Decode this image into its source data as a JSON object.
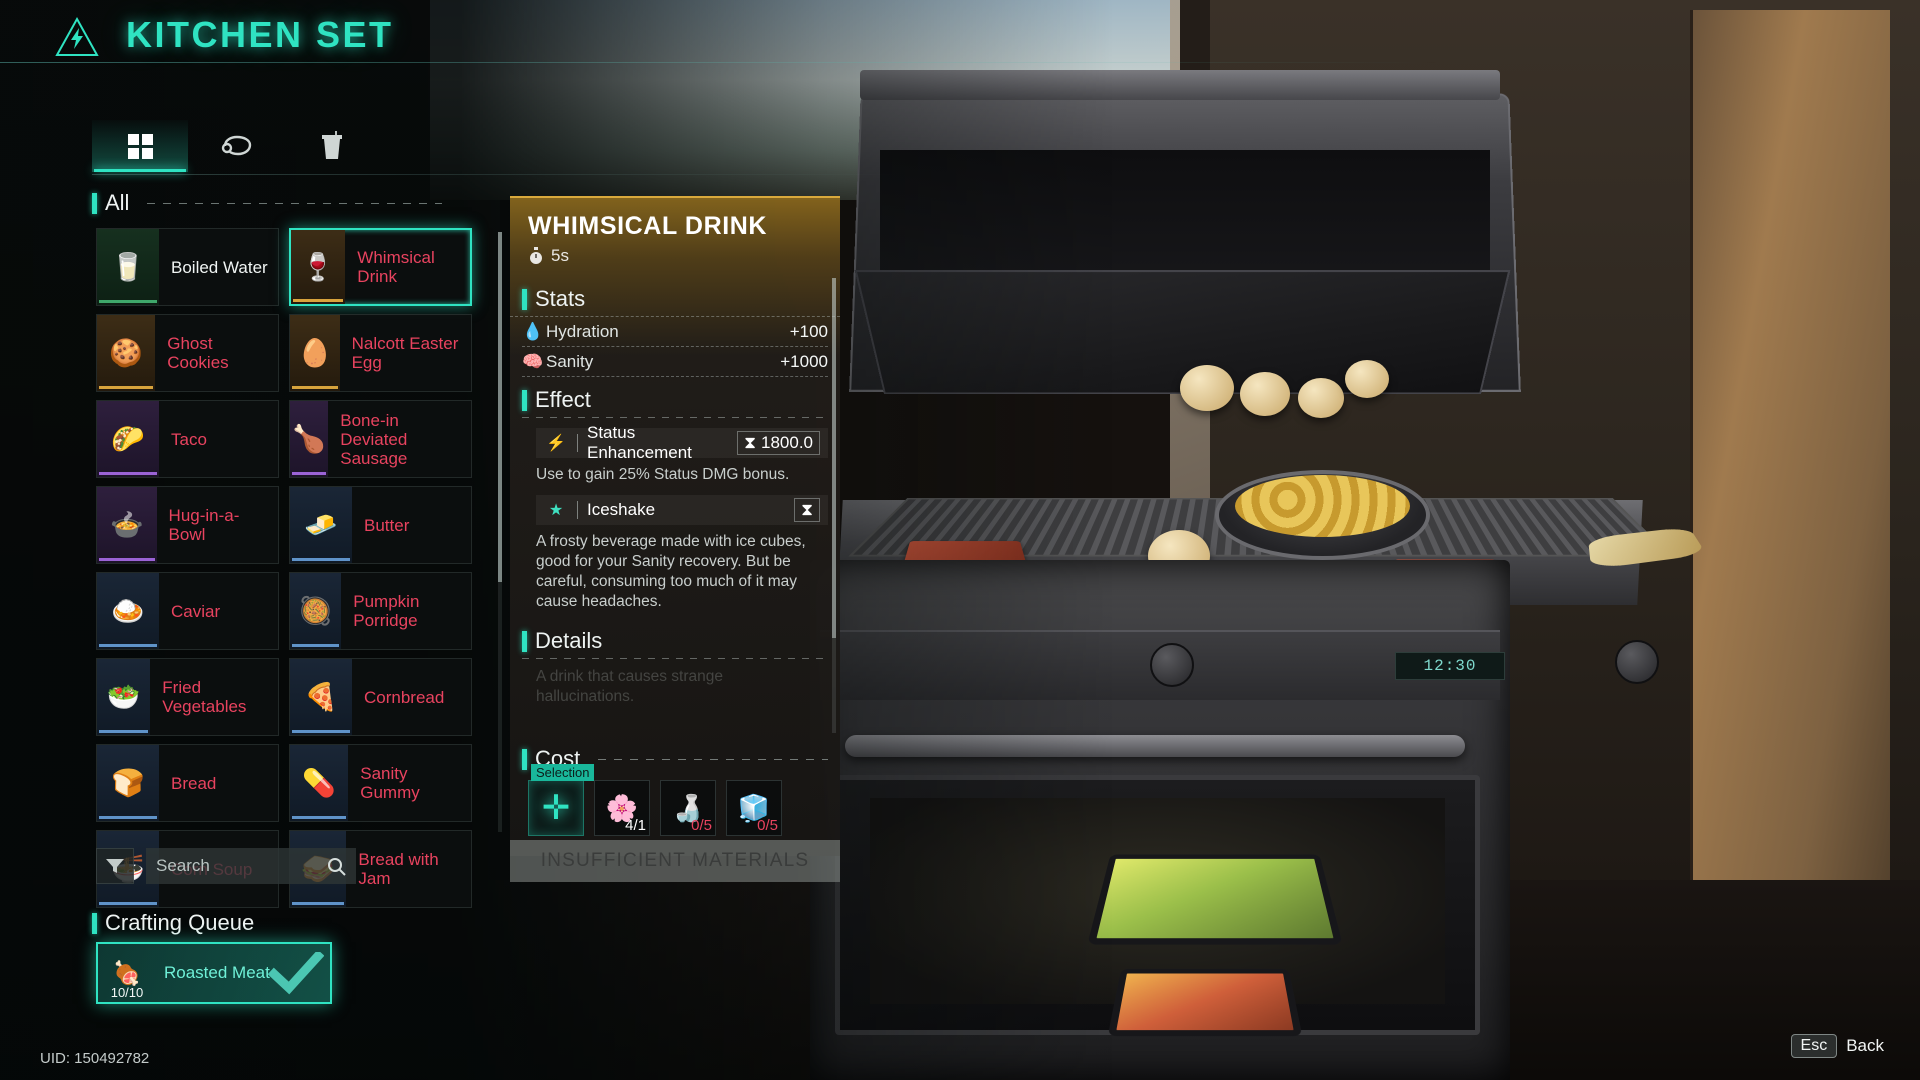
{
  "header": {
    "title": "KITCHEN SET",
    "warn_icon": "warning-lightning-icon"
  },
  "tabs": [
    {
      "id": "all",
      "icon": "grid-icon",
      "glyph": "▦",
      "active": true
    },
    {
      "id": "food",
      "icon": "meat-icon",
      "glyph": "🍖",
      "active": false
    },
    {
      "id": "drink",
      "icon": "drink-cup-icon",
      "glyph": "🥤",
      "active": false
    }
  ],
  "list": {
    "section_label": "All",
    "items": [
      {
        "name": "Boiled Water",
        "glyph": "🥛",
        "rarity": "green",
        "craftable": true
      },
      {
        "name": "Whimsical Drink",
        "glyph": "🍷",
        "rarity": "gold",
        "craftable": false,
        "selected": true
      },
      {
        "name": "Ghost Cookies",
        "glyph": "🍪",
        "rarity": "gold",
        "craftable": false
      },
      {
        "name": "Nalcott Easter Egg",
        "glyph": "🥚",
        "rarity": "gold",
        "craftable": false
      },
      {
        "name": "Taco",
        "glyph": "🌮",
        "rarity": "purple",
        "craftable": false
      },
      {
        "name": "Bone-in Deviated Sausage",
        "glyph": "🍗",
        "rarity": "purple",
        "craftable": false
      },
      {
        "name": "Hug-in-a-Bowl",
        "glyph": "🍲",
        "rarity": "purple",
        "craftable": false
      },
      {
        "name": "Butter",
        "glyph": "🧈",
        "rarity": "blue",
        "craftable": false
      },
      {
        "name": "Caviar",
        "glyph": "🍛",
        "rarity": "blue",
        "craftable": false
      },
      {
        "name": "Pumpkin Porridge",
        "glyph": "🥘",
        "rarity": "blue",
        "craftable": false
      },
      {
        "name": "Fried Vegetables",
        "glyph": "🥗",
        "rarity": "blue",
        "craftable": false
      },
      {
        "name": "Cornbread",
        "glyph": "🍕",
        "rarity": "blue",
        "craftable": false
      },
      {
        "name": "Bread",
        "glyph": "🍞",
        "rarity": "blue",
        "craftable": false
      },
      {
        "name": "Sanity Gummy",
        "glyph": "💊",
        "rarity": "blue",
        "craftable": false
      },
      {
        "name": "Corn Soup",
        "glyph": "🍜",
        "rarity": "blue",
        "craftable": false
      },
      {
        "name": "Bread with Jam",
        "glyph": "🥪",
        "rarity": "blue",
        "craftable": false
      }
    ]
  },
  "search": {
    "value": "Search",
    "placeholder": "Search",
    "icon": "search-icon",
    "filter_icon": "filter-icon"
  },
  "queue": {
    "label": "Crafting Queue",
    "items": [
      {
        "name": "Roasted Meat",
        "count": "10/10",
        "glyph": "🍖",
        "complete": true
      }
    ]
  },
  "uid": "UID: 150492782",
  "detail": {
    "title": "WHIMSICAL DRINK",
    "craft_time": "5s",
    "timer_icon": "stopwatch-icon",
    "stats_label": "Stats",
    "stats": [
      {
        "icon": "water-drop-icon",
        "glyph": "💧",
        "name": "Hydration",
        "value": "+100"
      },
      {
        "icon": "sanity-head-icon",
        "glyph": "🧠",
        "name": "Sanity",
        "value": "+1000"
      }
    ],
    "effect_label": "Effect",
    "effects": [
      {
        "icon": "lightning-bolt-icon",
        "glyph": "⚡",
        "name": "Status Enhancement",
        "duration_icon": "hourglass-icon",
        "duration": "1800.0",
        "desc": "Use to gain 25% Status DMG bonus."
      },
      {
        "icon": "star-icon",
        "glyph": "★",
        "name": "Iceshake",
        "duration_icon": "hourglass-icon",
        "duration": "",
        "desc": "A frosty beverage made with ice cubes, good for your Sanity recovery. But be careful, consuming too much of it may cause headaches."
      }
    ],
    "details_label": "Details",
    "details_text": "A drink that causes strange hallucinations.",
    "cost_label": "Cost",
    "selection": {
      "tooltip": "Selection",
      "glyph": "✛",
      "icon": "add-plus-icon"
    },
    "costs": [
      {
        "icon": "purple-flower-icon",
        "glyph": "🌸",
        "qty": "4/1",
        "sufficient": true
      },
      {
        "icon": "bottle-icon",
        "glyph": "🍶",
        "qty": "0/5",
        "sufficient": false
      },
      {
        "icon": "ice-cubes-icon",
        "glyph": "🧊",
        "qty": "0/5",
        "sufficient": false
      }
    ],
    "craft_button": "INSUFFICIENT MATERIALS"
  },
  "footer": {
    "key": "Esc",
    "label": "Back"
  },
  "oven": {
    "display": "12:30"
  },
  "colors": {
    "accent": "#2fe3c2",
    "locked_text": "#e8435f",
    "gold": "#d9a93c"
  }
}
